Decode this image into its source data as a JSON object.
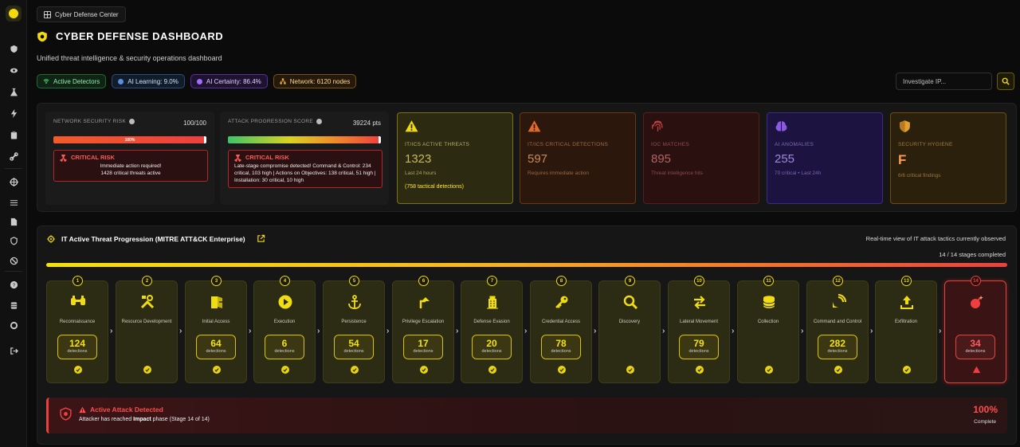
{
  "app": {
    "breadcrumb": "Cyber Defense Center",
    "title": "CYBER DEFENSE DASHBOARD",
    "subtitle": "Unified threat intelligence & security operations dashboard"
  },
  "status_pills": [
    {
      "label": "Active Detectors",
      "color": "#34d36a"
    },
    {
      "label": "AI Learning: 9.0%",
      "color": "#5b8de0"
    },
    {
      "label": "AI Certainty: 86.4%",
      "color": "#a46bff"
    },
    {
      "label": "Network: 6120 nodes",
      "color": "#f0b33a"
    }
  ],
  "search": {
    "placeholder": "Investigate IP..."
  },
  "scores": {
    "network": {
      "label": "NETWORK SECURITY RISK",
      "value": "100/100",
      "bar_label": "100%",
      "progress": 1.0,
      "alert_title": "CRITICAL RISK",
      "alert_lines": [
        "Immediate action required!",
        "1428 critical threats active"
      ]
    },
    "attack": {
      "label": "ATTACK PROGRESSION SCORE",
      "value": "39224 pts",
      "progress": 1.0,
      "alert_title": "CRITICAL RISK",
      "alert_text": "Late-stage compromise detected! Command & Control: 234 critical, 103 high | Actions on Objectives: 138 critical, 51 high | Installation: 30 critical, 10 high"
    }
  },
  "cards": [
    {
      "title": "IT/ICS ACTIVE THREATS",
      "value": "1323",
      "sub": "Last 24 hours",
      "extra": "(758 tactical detections)",
      "icon": "warning-triangle-icon"
    },
    {
      "title": "IT/ICS CRITICAL DETECTIONS",
      "value": "597",
      "sub": "Requires immediate action",
      "icon": "warning-triangle-icon"
    },
    {
      "title": "IOC MATCHES",
      "value": "895",
      "sub": "Threat intelligence hits",
      "icon": "fingerprint-icon"
    },
    {
      "title": "AI ANOMALIES",
      "value": "255",
      "sub": "70 critical • Last 24h",
      "icon": "brain-icon"
    },
    {
      "title": "SECURITY HYGIENE",
      "value": "F",
      "sub": "6/6 critical findings",
      "icon": "shield-icon"
    }
  ],
  "progression": {
    "title": "IT Active Threat Progression (MITRE ATT&CK Enterprise)",
    "right_note": "Real-time view of IT attack tactics currently observed",
    "count": "14 / 14 stages completed",
    "det_label": "detections",
    "stages": [
      {
        "n": "1",
        "name": "Reconnaissance",
        "count": "124"
      },
      {
        "n": "2",
        "name": "Resource Development",
        "count": ""
      },
      {
        "n": "3",
        "name": "Initial Access",
        "count": "64"
      },
      {
        "n": "4",
        "name": "Execution",
        "count": "6"
      },
      {
        "n": "5",
        "name": "Persistence",
        "count": "54"
      },
      {
        "n": "6",
        "name": "Privilege Escalation",
        "count": "17"
      },
      {
        "n": "7",
        "name": "Defense Evasion",
        "count": "20"
      },
      {
        "n": "8",
        "name": "Credential Access",
        "count": "78"
      },
      {
        "n": "9",
        "name": "Discovery",
        "count": ""
      },
      {
        "n": "10",
        "name": "Lateral Movement",
        "count": "79"
      },
      {
        "n": "11",
        "name": "Collection",
        "count": ""
      },
      {
        "n": "12",
        "name": "Command and Control",
        "count": "282"
      },
      {
        "n": "13",
        "name": "Exfiltration",
        "count": ""
      },
      {
        "n": "14",
        "name": "",
        "count": "34"
      }
    ]
  },
  "banner": {
    "title": "Active Attack Detected",
    "text_pre": "Attacker has reached",
    "text_bold": "Impact",
    "text_post": "phase (Stage 14 of 14)",
    "percent": "100%",
    "percent_label": "Complete"
  }
}
